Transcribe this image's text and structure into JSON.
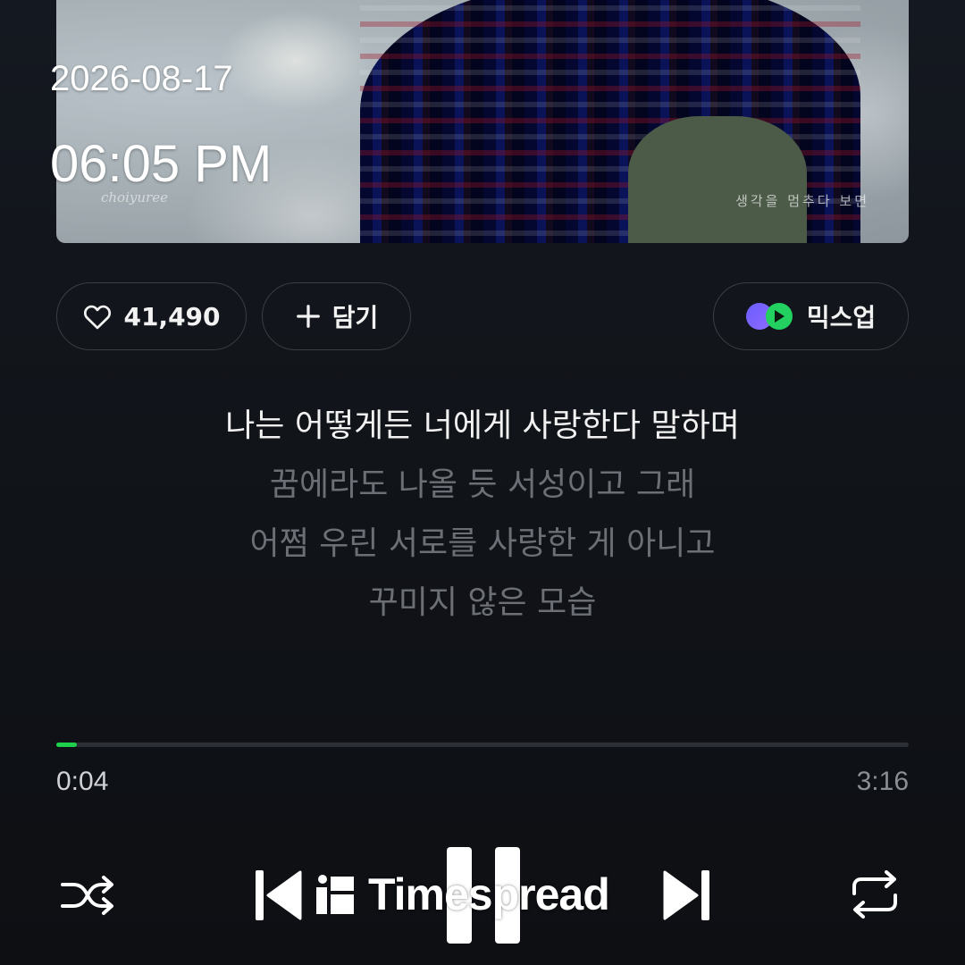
{
  "album": {
    "signature": "choiyuree",
    "caption": "생각을 멈추다 보면"
  },
  "overlay": {
    "date": "2026-08-17",
    "time": "06:05 PM"
  },
  "actions": {
    "like_count": "41,490",
    "add_label": "담기",
    "mixup_label": "믹스업"
  },
  "lyrics": [
    {
      "text": "나는 어떻게든 너에게 사랑한다 말하며",
      "active": true
    },
    {
      "text": "꿈에라도 나올 듯 서성이고 그래",
      "active": false
    },
    {
      "text": "어쩜 우린 서로를 사랑한 게 아니고",
      "active": false
    },
    {
      "text": "꾸미지 않은 모습",
      "active": false
    }
  ],
  "playback": {
    "current_time": "0:04",
    "total_time": "3:16",
    "progress_fraction": 0.024
  },
  "colors": {
    "accent": "#1fd04d",
    "mixup_purple": "#6a5cff",
    "mixup_green": "#23d160"
  },
  "icons": {
    "like": "heart-outline-icon",
    "add": "plus-icon",
    "mixup": "mixup-icon",
    "shuffle": "shuffle-icon",
    "prev": "skip-previous-icon",
    "pause": "pause-icon",
    "next": "skip-next-icon",
    "repeat": "repeat-icon"
  },
  "watermark": {
    "text": "Timespread"
  }
}
